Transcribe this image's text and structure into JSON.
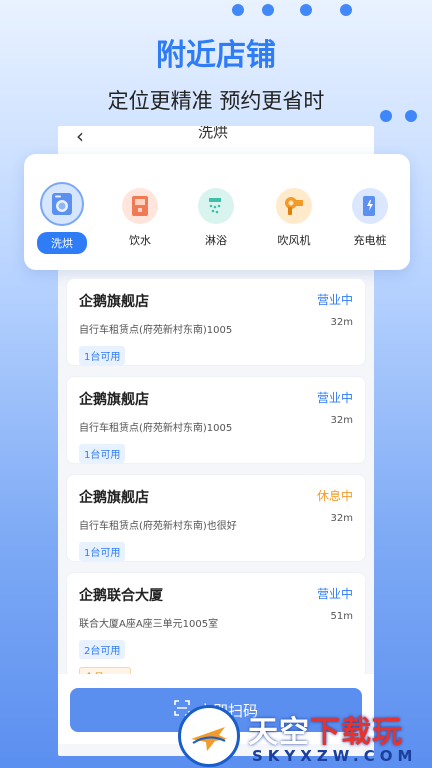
{
  "promo": {
    "headline": "附近店铺",
    "subline": "定位更精准 预约更省时"
  },
  "phone_header": {
    "title": "洗烘"
  },
  "categories": [
    {
      "label": "洗烘",
      "icon": "washing-machine-icon",
      "active": true
    },
    {
      "label": "饮水",
      "icon": "water-dispenser-icon",
      "active": false
    },
    {
      "label": "淋浴",
      "icon": "shower-icon",
      "active": false
    },
    {
      "label": "吹风机",
      "icon": "hair-dryer-icon",
      "active": false
    },
    {
      "label": "充电桩",
      "icon": "charging-pile-icon",
      "active": false
    }
  ],
  "stores": [
    {
      "name": "企鹅旗舰店",
      "status": "营业中",
      "address": "自行车租赁点(府苑新村东南)1005",
      "distance": "32m",
      "available": "1台可用"
    },
    {
      "name": "企鹅旗舰店",
      "status": "营业中",
      "address": "自行车租赁点(府苑新村东南)1005",
      "distance": "32m",
      "available": "1台可用"
    },
    {
      "name": "企鹅旗舰店",
      "status": "休息中",
      "address": "自行车租赁点(府苑新村东南)也很好",
      "distance": "32m",
      "available": "1台可用"
    },
    {
      "name": "企鹅联合大厦",
      "status": "营业中",
      "address": "联合大厦A座A座三单元1005室",
      "distance": "51m",
      "available": "2台可用",
      "member": "会员5.0折"
    }
  ],
  "scan_button": {
    "label": "立即扫码"
  },
  "watermark": {
    "name_part1": "天空",
    "name_part2": "下载玩",
    "domain": "SKYXZW.COM"
  },
  "colors": {
    "accent": "#2f7cf7",
    "rest_status": "#f29b2b"
  }
}
